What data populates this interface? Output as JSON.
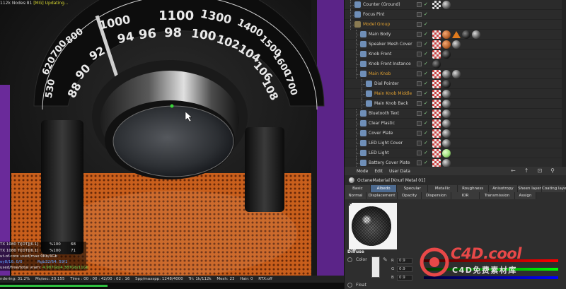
{
  "viewport": {
    "top_text_prefix": "112k Nodes:81",
    "top_text_status": "[MG] Updating...",
    "dial": {
      "outer_numbers": [
        "530",
        "620",
        "700",
        "800",
        "1000",
        "1100",
        "1300",
        "1400",
        "1500",
        "1600",
        "1700"
      ],
      "inner_numbers": [
        "88",
        "90",
        "92",
        "94",
        "96",
        "98",
        "100",
        "102",
        "104",
        "106",
        "108"
      ]
    },
    "stats": {
      "gpus": [
        {
          "name": "TX 1080 Ti[DT][6.1]",
          "pct": "%100",
          "temp": "68"
        },
        {
          "name": "TX 1080 Ti[DT][6.1]",
          "pct": "%100",
          "temp": "71"
        }
      ],
      "out_of_core": "ut-of-core used/max:0Kb/4Gb",
      "geo_line_left": "ey8/16: 0/0",
      "geo_line_right": "Rgb32/64: 59/1",
      "vram": "used/free/total vram:",
      "vram_values": "4.987Gb/4.387Gb/11Gb"
    },
    "statusbar": {
      "rendering": "ndering: 31.2%",
      "ms_sec": "Ms/sec: 20.155",
      "time": "Time : 00 : 00 : 42/00 : 02 : 16",
      "spp": "Spp/maxspp: 1248/4000",
      "tri": "Tri: 1k/112k",
      "mesh": "Mesh: 23",
      "hair": "Hair: 0",
      "rtx": "RTX:off"
    },
    "progress": 0.312
  },
  "object_manager": {
    "rows": [
      {
        "label": "Counter (Ground)",
        "indent": 1,
        "color": "normal",
        "tags": [
          "checker2",
          "sphere"
        ]
      },
      {
        "label": "Focus Pint",
        "indent": 1,
        "color": "normal",
        "tags": []
      },
      {
        "label": "Model Group",
        "indent": 1,
        "color": "null",
        "tags": []
      },
      {
        "label": "Main Body",
        "indent": 2,
        "color": "normal",
        "tags": [
          "checker",
          "sphere-orange",
          "tri",
          "sphere-dark",
          "sphere"
        ]
      },
      {
        "label": "Speaker Mesh Cover",
        "indent": 2,
        "color": "normal",
        "tags": [
          "checker",
          "sphere-orange",
          "sphere"
        ]
      },
      {
        "label": "Knob Front",
        "indent": 2,
        "color": "normal",
        "tags": [
          "checker",
          "sphere-dark"
        ]
      },
      {
        "label": "Knob Front Instance",
        "indent": 2,
        "color": "normal",
        "tags": [
          "sphere-dark"
        ]
      },
      {
        "label": "Main Knob",
        "indent": 2,
        "color": "orange",
        "tags": [
          "checker",
          "sphere",
          "sphere"
        ]
      },
      {
        "label": "Dial Pointer",
        "indent": 3,
        "color": "normal",
        "tags": [
          "checker",
          "sphere-dark"
        ]
      },
      {
        "label": "Main Knob Middle",
        "indent": 3,
        "color": "orange",
        "tags": [
          "checker",
          "sphere"
        ]
      },
      {
        "label": "Main Knob Back",
        "indent": 3,
        "color": "normal",
        "tags": [
          "checker",
          "sphere"
        ]
      },
      {
        "label": "Bluetooth Text",
        "indent": 2,
        "color": "normal",
        "tags": [
          "checker",
          "sphere"
        ]
      },
      {
        "label": "Clear Plastic",
        "indent": 2,
        "color": "normal",
        "tags": [
          "checker",
          "sphere"
        ]
      },
      {
        "label": "Cover Plate",
        "indent": 2,
        "color": "normal",
        "tags": [
          "checker",
          "sphere"
        ]
      },
      {
        "label": "LED Light Cover",
        "indent": 2,
        "color": "normal",
        "tags": [
          "checker",
          "sphere"
        ]
      },
      {
        "label": "LED Light",
        "indent": 2,
        "color": "normal",
        "tags": [
          "checker",
          "sphere-green"
        ]
      },
      {
        "label": "Battery Cover Plate",
        "indent": 2,
        "color": "normal",
        "tags": [
          "checker",
          "sphere"
        ]
      }
    ]
  },
  "attribute_manager": {
    "menu": [
      "Mode",
      "Edit",
      "User Data"
    ],
    "title": "OctaneMaterial [Knurl Metal 01]",
    "tabs_row1": [
      "Basic",
      "Albedo",
      "Specular",
      "Metallic",
      "Roughness",
      "Anisotropy",
      "Sheen layer",
      "Coating layer"
    ],
    "tabs_row2": [
      "Normal",
      "Displacement",
      "Opacity",
      "Dispersion",
      "IOR",
      "Transmission",
      "Assign"
    ],
    "active_tab": "Albedo",
    "section": "Diffuse",
    "color_label": "Color",
    "r": {
      "label": "R",
      "value": "0.9"
    },
    "g": {
      "label": "G",
      "value": "0.9"
    },
    "b": {
      "label": "B",
      "value": "0.9"
    },
    "float_label": "Float",
    "colors": {
      "accent_tab": "#4d6a8f",
      "swatch": "#e9e9e9"
    }
  },
  "watermark": {
    "title": "C4D.cool",
    "subtitle": "C4D免费素材库"
  }
}
